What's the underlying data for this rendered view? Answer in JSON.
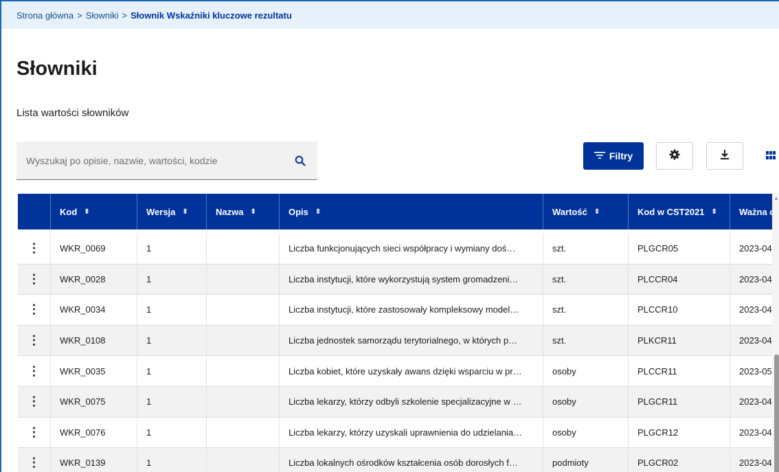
{
  "breadcrumb": {
    "items": [
      "Strona główna",
      "Słowniki"
    ],
    "separator": ">",
    "current": "Słownik Wskaźniki kluczowe rezultatu"
  },
  "page": {
    "title": "Słowniki",
    "subtitle": "Lista wartości słowników"
  },
  "search": {
    "placeholder": "Wyszukaj po opisie, nazwie, wartości, kodzie",
    "value": ""
  },
  "toolbar": {
    "filter_label": "Filtry"
  },
  "table": {
    "columns": [
      "",
      "Kod",
      "Wersja",
      "Nazwa",
      "Opis",
      "Wartość",
      "Kod w CST2021",
      "Ważna od"
    ],
    "rows": [
      [
        "WKR_0069",
        "1",
        "",
        "Liczba funkcjonujących sieci współpracy i wymiany doś…",
        "szt.",
        "PLGCR05",
        "2023-04"
      ],
      [
        "WKR_0028",
        "1",
        "",
        "Liczba instytucji, które wykorzystują system gromadzeni…",
        "szt.",
        "PLCCR04",
        "2023-04"
      ],
      [
        "WKR_0034",
        "1",
        "",
        "Liczba instytucji, które zastosowały kompleksowy model…",
        "szt.",
        "PLCCR10",
        "2023-04"
      ],
      [
        "WKR_0108",
        "1",
        "",
        "Liczba jednostek samorządu terytorialnego, w których p…",
        "szt.",
        "PLKCR11",
        "2023-04"
      ],
      [
        "WKR_0035",
        "1",
        "",
        "Liczba kobiet, które uzyskały awans dzięki wsparciu w pr…",
        "osoby",
        "PLCCR11",
        "2023-05"
      ],
      [
        "WKR_0075",
        "1",
        "",
        "Liczba lekarzy, którzy odbyli szkolenie specjalizacyjne w …",
        "osoby",
        "PLGCR11",
        "2023-04"
      ],
      [
        "WKR_0076",
        "1",
        "",
        "Liczba lekarzy, którzy uzyskali uprawnienia do udzielania…",
        "osoby",
        "PLGCR12",
        "2023-04"
      ],
      [
        "WKR_0139",
        "1",
        "",
        "Liczba lokalnych ośrodków kształcenia osób dorosłych f…",
        "podmioty",
        "PLGCR02",
        "2023-04"
      ]
    ]
  },
  "icons": {
    "search": "search-icon",
    "filter": "filter-icon",
    "settings": "gear-icon",
    "download": "download-icon",
    "grid": "grid-icon",
    "row_menu": "kebab-menu-icon",
    "sort": "sort-icon"
  },
  "colors": {
    "primary": "#003399",
    "breadcrumb_bg": "#e6f1fb",
    "row_alt": "#f2f2f2"
  }
}
